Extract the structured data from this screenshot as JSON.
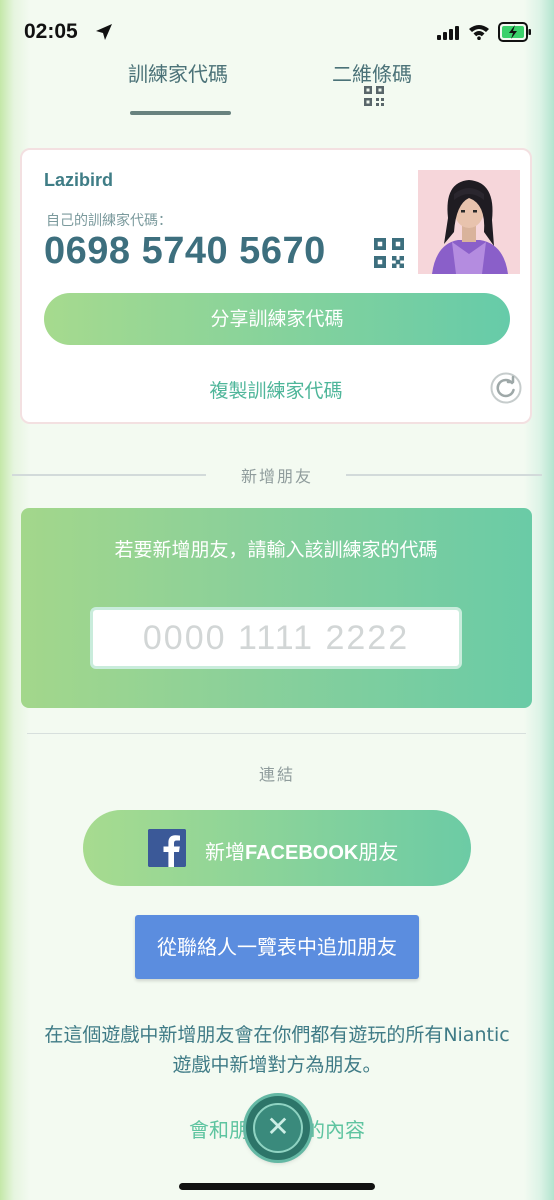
{
  "status_bar": {
    "time": "02:05",
    "icons": [
      "location-arrow-icon",
      "signal-bars-icon",
      "wifi-icon",
      "battery-charging-icon"
    ]
  },
  "tabs": [
    {
      "label": "訓練家代碼",
      "selected": true
    },
    {
      "label": "二維條碼",
      "icon": "qr-code-icon",
      "selected": false
    }
  ],
  "trainer_card": {
    "username": "Lazibird",
    "code_label": "自己的訓練家代碼：",
    "code_value": "0698 5740 5670",
    "share_label": "分享訓練家代碼",
    "copy_label": "複製訓練家代碼",
    "icons": [
      "qr-code-icon",
      "trainer-avatar",
      "refresh-icon"
    ]
  },
  "add_friend": {
    "section_title": "新增朋友",
    "prompt": "若要新增朋友，請輸入該訓練家的代碼",
    "input_placeholder": "0000 1111 2222"
  },
  "connect": {
    "section_title": "連結",
    "facebook_prefix": "新增",
    "facebook_brand": "FACEBOOK",
    "facebook_suffix": "朋友",
    "contacts_label": "從聯絡人一覽表中追加朋友",
    "info_text": "在這個遊戲中新增朋友會在你們都有遊玩的所有Niantic遊戲中新增對方為朋友。",
    "bottom_left": "會和朋",
    "bottom_right": "的內容"
  },
  "close_icon": "✕",
  "colors": {
    "accent_teal": "#3d6f7e",
    "gradient_start": "#a6da8e",
    "gradient_end": "#66cba9",
    "contacts_blue": "#5b8ddf",
    "facebook_blue": "#3b5998"
  }
}
